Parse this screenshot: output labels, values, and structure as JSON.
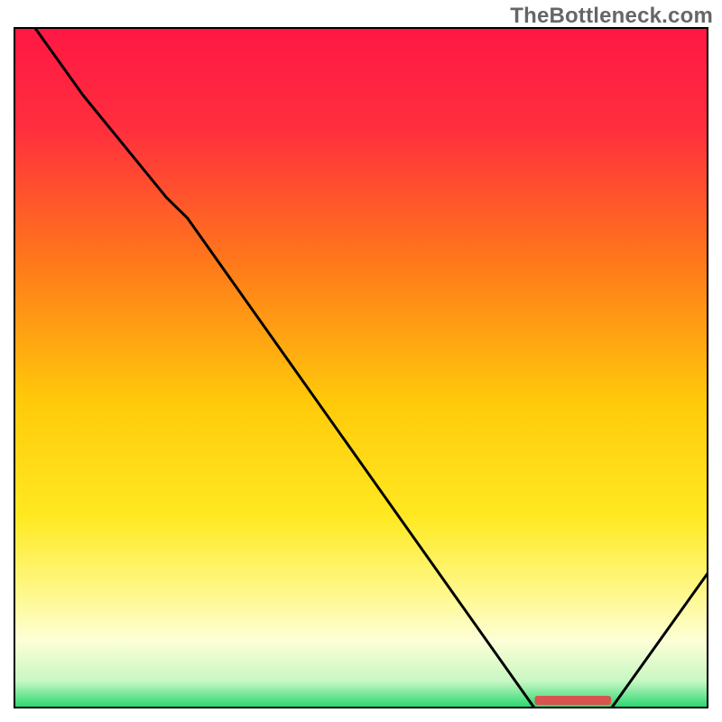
{
  "watermark": "TheBottleneck.com",
  "chart_data": {
    "type": "line",
    "title": "",
    "xlabel": "",
    "ylabel": "",
    "xlim": [
      0,
      100
    ],
    "ylim": [
      0,
      100
    ],
    "gradient_stops": [
      {
        "offset": 0,
        "color": "#ff1744"
      },
      {
        "offset": 15,
        "color": "#ff2f3e"
      },
      {
        "offset": 35,
        "color": "#ff7a1a"
      },
      {
        "offset": 55,
        "color": "#ffca0a"
      },
      {
        "offset": 72,
        "color": "#ffe922"
      },
      {
        "offset": 83,
        "color": "#fff88a"
      },
      {
        "offset": 90,
        "color": "#fdffd6"
      },
      {
        "offset": 96,
        "color": "#c8f7c3"
      },
      {
        "offset": 100,
        "color": "#1fd66a"
      }
    ],
    "series": [
      {
        "name": "bottleneck-curve",
        "x": [
          3.0,
          10.0,
          22.0,
          25.0,
          75.0,
          82.0,
          86.0,
          100.0
        ],
        "y": [
          100.0,
          90.0,
          75.0,
          72.0,
          0.0,
          0.0,
          0.0,
          20.0
        ]
      }
    ],
    "markers": [
      {
        "name": "optimal-range-marker",
        "x_start": 75,
        "x_end": 86,
        "color": "#d9534f"
      }
    ]
  }
}
